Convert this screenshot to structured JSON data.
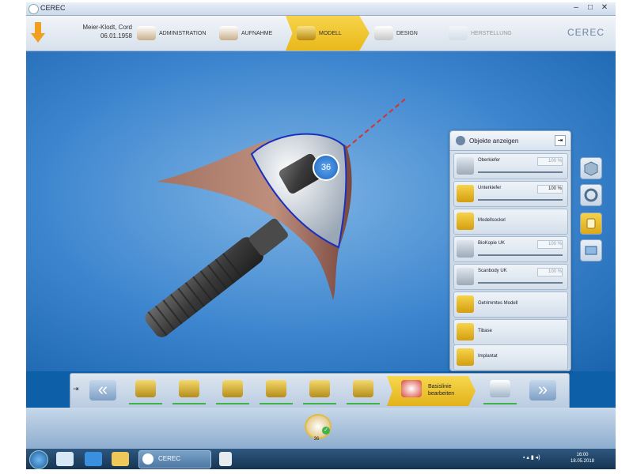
{
  "window": {
    "title": "CEREC",
    "controls": [
      "minimize-icon",
      "restore-icon",
      "close-icon"
    ]
  },
  "patient": {
    "name": "Meier-Klodt, Cord",
    "dob": "06.01.1958"
  },
  "nav": {
    "steps": [
      {
        "label": "ADMINISTRATION",
        "state": "done"
      },
      {
        "label": "AUFNAHME",
        "state": "done"
      },
      {
        "label": "MODELL",
        "state": "active"
      },
      {
        "label": "DESIGN",
        "state": "next"
      },
      {
        "label": "HERSTELLUNG",
        "state": "disabled"
      }
    ],
    "brand": "CEREC"
  },
  "viewport": {
    "tooth_badge": "36"
  },
  "objects_panel": {
    "title": "Objekte anzeigen",
    "items": [
      {
        "label": "Oberkiefer",
        "value": "100 %",
        "enabled": false,
        "opacity": 1.0
      },
      {
        "label": "Unterkiefer",
        "value": "100 %",
        "enabled": true,
        "opacity": 1.0
      },
      {
        "label": "Modellsockel"
      },
      {
        "label": "BioKopie UK",
        "value": "100 %",
        "enabled": false,
        "opacity": 1.0
      },
      {
        "label": "Scanbody UK",
        "value": "100 %",
        "enabled": false,
        "opacity": 1.0
      },
      {
        "label": "Getrimmtes Modell"
      },
      {
        "label": "Tibase"
      },
      {
        "label": "Implantat"
      }
    ]
  },
  "side_tools": [
    "cube-view-icon",
    "rotate-icon",
    "tool-active-icon",
    "screenshot-icon"
  ],
  "toolbar": {
    "active_label": "Basislinie bearbeiten",
    "tools": [
      "tool-1-icon",
      "tool-2-icon",
      "tool-3-icon",
      "tool-4-icon",
      "tool-5-icon",
      "tool-6-icon"
    ],
    "trailing_tool": "tool-8-icon"
  },
  "bottom": {
    "tooth_number": "36"
  },
  "taskbar": {
    "task_label": "CEREC",
    "time": "16:00",
    "date": "18.05.2018"
  },
  "colors": {
    "accent": "#f2c531",
    "desktop": "#1a63ad",
    "progress": "#3fb24a"
  }
}
